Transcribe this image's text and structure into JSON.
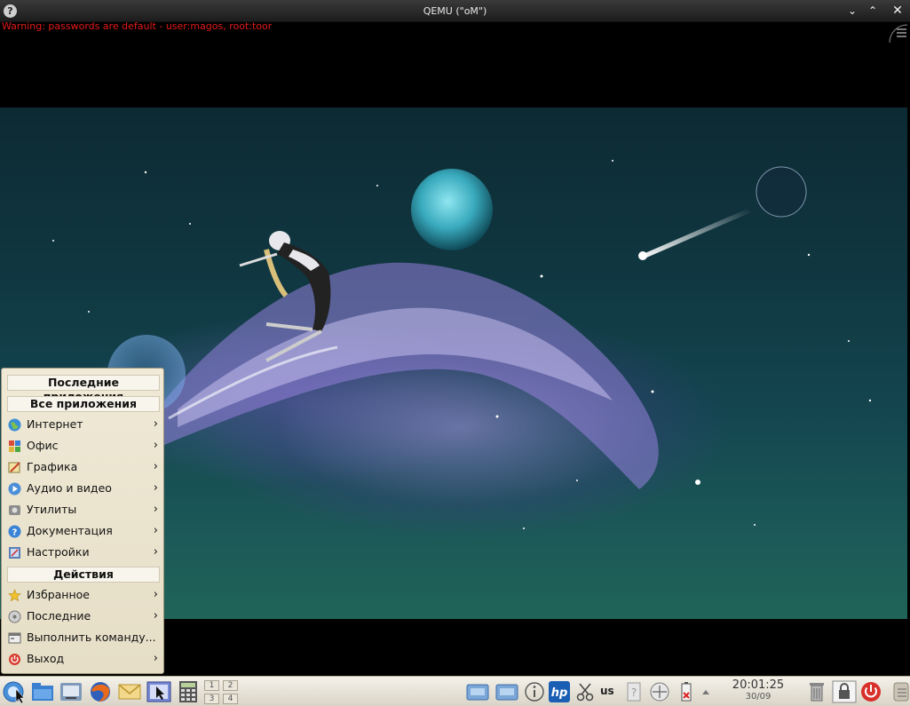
{
  "window": {
    "title": "QEMU (\"oM\")",
    "help_glyph": "?",
    "menu_glyph": "⌄",
    "maximize_glyph": "⌃",
    "close_glyph": "✕"
  },
  "warning": "Warning: passwords are default - user:magos, root:toor",
  "start_menu": {
    "recent_apps_header": "Последние приложения",
    "all_apps_header": "Все приложения",
    "categories": [
      {
        "label": "Интернет",
        "icon": "globe-icon"
      },
      {
        "label": "Офис",
        "icon": "office-icon"
      },
      {
        "label": "Графика",
        "icon": "graphics-icon"
      },
      {
        "label": "Аудио и видео",
        "icon": "multimedia-icon"
      },
      {
        "label": "Утилиты",
        "icon": "utilities-icon"
      },
      {
        "label": "Документация",
        "icon": "help-icon"
      },
      {
        "label": "Настройки",
        "icon": "settings-icon"
      }
    ],
    "actions_header": "Действия",
    "actions": [
      {
        "label": "Избранное",
        "icon": "star-icon",
        "submenu": true
      },
      {
        "label": "Последние",
        "icon": "recent-icon",
        "submenu": true
      },
      {
        "label": "Выполнить команду...",
        "icon": "run-icon",
        "submenu": false
      },
      {
        "label": "Выход",
        "icon": "power-icon",
        "submenu": true
      }
    ],
    "arrow_glyph": "›"
  },
  "taskbar": {
    "pager": [
      "1",
      "2",
      "3",
      "4"
    ],
    "keyboard_layout": "us",
    "clock_time": "20:01:25",
    "clock_date": "30/09"
  }
}
